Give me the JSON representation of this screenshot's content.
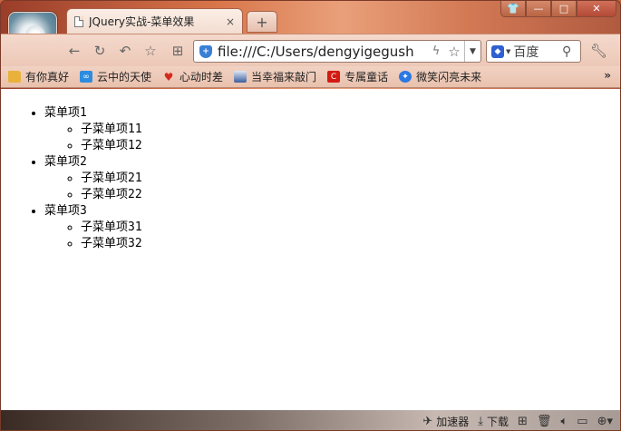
{
  "browser": {
    "tab_title": "JQuery实战-菜单效果",
    "tab_close": "×",
    "new_tab": "+",
    "window_buttons": [
      "👕",
      "—",
      "□",
      "✕"
    ],
    "url": "file:///C:/Users/dengyigegush",
    "search_engine": "百度",
    "accent": "#d8764a"
  },
  "bookmarks": [
    {
      "label": "有你真好",
      "icon": "folder-icon"
    },
    {
      "label": "云中的天使",
      "icon": "cloud-icon"
    },
    {
      "label": "心动时差",
      "icon": "heart-icon"
    },
    {
      "label": "当幸福来敲门",
      "icon": "mountain-icon"
    },
    {
      "label": "专属童话",
      "icon": "c-logo-icon"
    },
    {
      "label": "微笑闪亮未来",
      "icon": "leaf-icon"
    }
  ],
  "bookmarks_more": "»",
  "menu": [
    {
      "label": "菜单项1",
      "children": [
        "子菜单项11",
        "子菜单项12"
      ]
    },
    {
      "label": "菜单项2",
      "children": [
        "子菜单项21",
        "子菜单项22"
      ]
    },
    {
      "label": "菜单项3",
      "children": [
        "子菜单项31",
        "子菜单项32"
      ]
    }
  ],
  "statusbar": {
    "accelerator": "加速器",
    "download": "下载"
  }
}
